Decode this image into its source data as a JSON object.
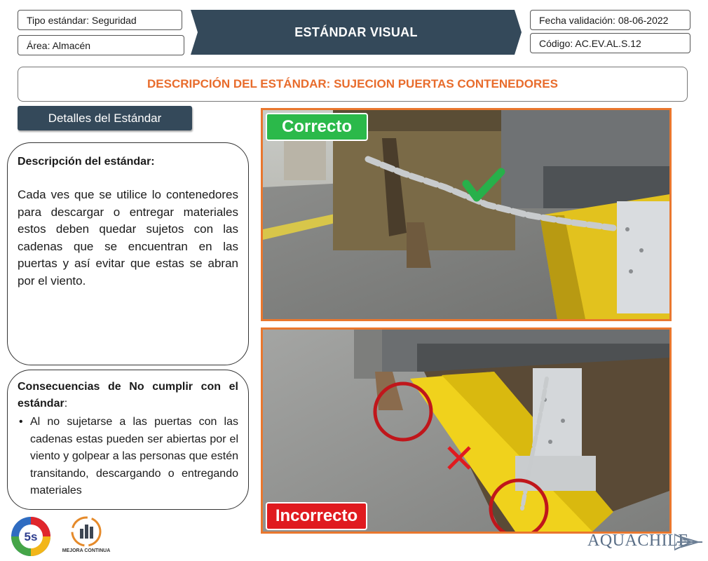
{
  "header": {
    "tipo": "Tipo estándar: Seguridad",
    "area": "Área: Almacén",
    "title": "ESTÁNDAR VISUAL",
    "fecha": "Fecha validación: 08-06-2022",
    "codigo": "Código: AC.EV.AL.S.12"
  },
  "description_bar": "DESCRIPCIÓN DEL ESTÁNDAR: SUJECION PUERTAS CONTENEDORES",
  "details_button": "Detalles del Estándar",
  "panel_desc": {
    "title": "Descripción del estándar:",
    "body": "Cada ves que se utilice lo contenedores para descargar o entregar materiales estos deben quedar sujetos con las cadenas que se encuentran en las puertas y así evitar que estas se abran por el viento."
  },
  "panel_cons": {
    "title_bold": "Consecuencias de No cumplir con el estándar",
    "title_suffix": ":",
    "items": [
      "Al no sujetarse a las puertas con las cadenas estas pueden ser abiertas por el viento y golpear a las personas que estén transitando,  descargando o entregando materiales"
    ]
  },
  "photos": {
    "correct_label": "Correcto",
    "incorrect_label": "Incorrecto"
  },
  "logos": {
    "five_s": "5s",
    "mejora": "MEJORA CONTINUA",
    "brand": "AQUACHILE"
  },
  "colors": {
    "accent_orange": "#e86c2c",
    "banner_navy": "#34495a",
    "correct_green": "#2bb94a",
    "incorrect_red": "#e01a1f"
  }
}
